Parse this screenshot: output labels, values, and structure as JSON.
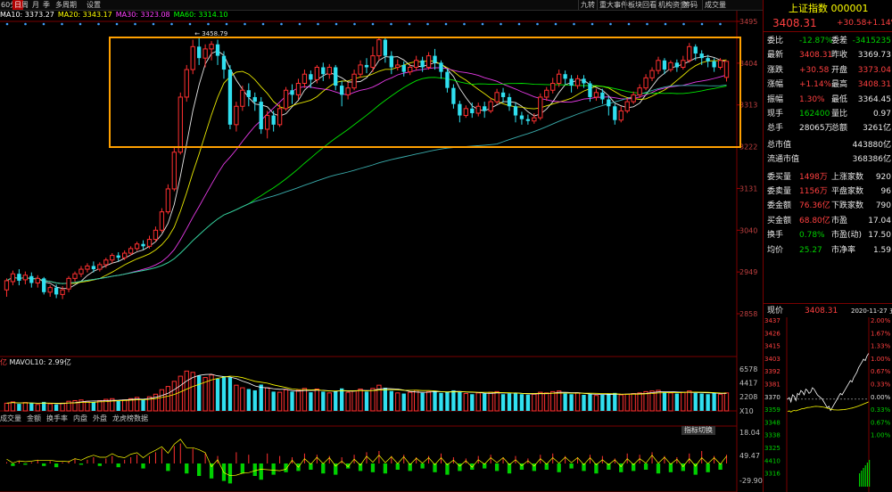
{
  "toolbar": {
    "left_items": [
      "60分",
      "日",
      "周",
      "月",
      "季",
      "多周期",
      "设置"
    ],
    "active_index": 1,
    "right_items": [
      "九转",
      "重大事件",
      "板块回看",
      "机构资金",
      "筹码",
      "成交量"
    ]
  },
  "ma_legend": [
    {
      "label": "MA10: 3373.27",
      "color": "#ffffff"
    },
    {
      "label": "MA20: 3343.17",
      "color": "#ffff00"
    },
    {
      "label": "MA30: 3323.08",
      "color": "#ff40ff"
    },
    {
      "label": "MA60: 3314.10",
      "color": "#00ff00"
    }
  ],
  "highlight_label": "3458.79",
  "annotations": {
    "peak_value": "3458.79"
  },
  "price_axis": [
    "3495",
    "3404",
    "3313",
    "3222",
    "3131",
    "3040",
    "2949",
    "2858"
  ],
  "volume_legend": {
    "prefix": "亿",
    "label": "MAVOL10: 2.99亿"
  },
  "volume_axis": [
    "6578",
    "4417",
    "2208",
    "X10"
  ],
  "bottom_tabs": [
    "成交量",
    "金额",
    "换手率",
    "内盘",
    "外盘",
    "龙虎榜数据"
  ],
  "indicator_button": "指标切换",
  "indicator_axis": [
    "18.04",
    "49.47",
    "-29.90"
  ],
  "right_panel": {
    "title": "上证指数 000001",
    "price": "3408.31",
    "change": "+30.58",
    "change_pct": "+1.14%",
    "rows": [
      {
        "l": "委比",
        "v": "-12.87%",
        "l2": "委差",
        "v2": "-3415235"
      },
      {
        "l": "最新",
        "v": "3408.31",
        "l2": "昨收",
        "v2": "3369.73"
      },
      {
        "l": "涨跌",
        "v": "+30.58",
        "l2": "开盘",
        "v2": "3373.04"
      },
      {
        "l": "涨幅",
        "v": "+1.14%",
        "l2": "最高",
        "v2": "3408.31"
      },
      {
        "l": "振幅",
        "v": "1.30%",
        "l2": "最低",
        "v2": "3364.45"
      },
      {
        "l": "现手",
        "v": "162400",
        "l2": "量比",
        "v2": "0.97"
      },
      {
        "l": "总手",
        "v": "28065万",
        "l2": "总额",
        "v2": "3261亿"
      },
      {
        "l": "总市值",
        "v": "",
        "l2": "",
        "v2": "443880亿"
      },
      {
        "l": "流通市值",
        "v": "",
        "l2": "",
        "v2": "368386亿"
      },
      {
        "l": "委买量",
        "v": "1498万",
        "l2": "上涨家数",
        "v2": "920"
      },
      {
        "l": "委卖量",
        "v": "1156万",
        "l2": "平盘家数",
        "v2": "96"
      },
      {
        "l": "委金额",
        "v": "76.36亿",
        "l2": "下跌家数",
        "v2": "790"
      },
      {
        "l": "买金额",
        "v": "68.80亿",
        "l2": "市盈",
        "v2": "17.04"
      },
      {
        "l": "换手",
        "v": "0.78%",
        "l2": "市盈(动)",
        "v2": "17.50"
      },
      {
        "l": "均价",
        "v": "25.27",
        "l2": "市净率",
        "v2": "1.59"
      }
    ],
    "intraday_header": {
      "label": "现价",
      "value": "3408.31",
      "date": "2020-11-27 五"
    },
    "intraday_left_axis": [
      "3437",
      "3426",
      "3415",
      "3403",
      "3392",
      "3381",
      "3370",
      "3359",
      "3348",
      "3338",
      "3325",
      "4410",
      "3316"
    ],
    "intraday_right_axis": [
      "2.00%",
      "1.67%",
      "1.33%",
      "1.00%",
      "0.67%",
      "0.33%",
      "0.00%",
      "0.33%",
      "0.67%",
      "1.00%"
    ]
  },
  "colors": {
    "up": "#ff3030",
    "down": "#30e0f0",
    "box": "#ffa000",
    "bg": "#000000"
  },
  "chart_data": {
    "type": "candlestick",
    "price_range": [
      2858,
      3495
    ],
    "candles": [
      [
        2910,
        2930,
        2895,
        2935
      ],
      [
        2928,
        2945,
        2920,
        2952
      ],
      [
        2945,
        2930,
        2920,
        2955
      ],
      [
        2932,
        2942,
        2922,
        2950
      ],
      [
        2940,
        2925,
        2915,
        2948
      ],
      [
        2925,
        2935,
        2915,
        2942
      ],
      [
        2935,
        2905,
        2900,
        2938
      ],
      [
        2905,
        2915,
        2895,
        2920
      ],
      [
        2915,
        2900,
        2892,
        2922
      ],
      [
        2900,
        2910,
        2890,
        2918
      ],
      [
        2912,
        2935,
        2905,
        2940
      ],
      [
        2935,
        2945,
        2928,
        2950
      ],
      [
        2945,
        2955,
        2938,
        2962
      ],
      [
        2955,
        2962,
        2948,
        2968
      ],
      [
        2962,
        2955,
        2948,
        2972
      ],
      [
        2955,
        2965,
        2950,
        2970
      ],
      [
        2965,
        2975,
        2958,
        2980
      ],
      [
        2975,
        2985,
        2968,
        2990
      ],
      [
        2985,
        2980,
        2972,
        2992
      ],
      [
        2980,
        2990,
        2975,
        2996
      ],
      [
        2990,
        3000,
        2985,
        3005
      ],
      [
        3000,
        3010,
        2995,
        3015
      ],
      [
        3010,
        3005,
        2998,
        3018
      ],
      [
        3005,
        3020,
        3000,
        3028
      ],
      [
        3020,
        3040,
        3015,
        3048
      ],
      [
        3040,
        3080,
        3035,
        3088
      ],
      [
        3080,
        3130,
        3075,
        3140
      ],
      [
        3130,
        3210,
        3125,
        3220
      ],
      [
        3210,
        3330,
        3205,
        3340
      ],
      [
        3330,
        3390,
        3320,
        3400
      ],
      [
        3390,
        3440,
        3380,
        3455
      ],
      [
        3440,
        3415,
        3400,
        3458
      ],
      [
        3415,
        3435,
        3395,
        3445
      ],
      [
        3435,
        3445,
        3410,
        3452
      ],
      [
        3445,
        3420,
        3400,
        3455
      ],
      [
        3420,
        3390,
        3370,
        3430
      ],
      [
        3390,
        3270,
        3260,
        3400
      ],
      [
        3270,
        3310,
        3255,
        3320
      ],
      [
        3310,
        3345,
        3300,
        3355
      ],
      [
        3345,
        3330,
        3310,
        3360
      ],
      [
        3330,
        3320,
        3300,
        3340
      ],
      [
        3320,
        3260,
        3250,
        3330
      ],
      [
        3260,
        3290,
        3240,
        3300
      ],
      [
        3290,
        3270,
        3255,
        3300
      ],
      [
        3270,
        3305,
        3265,
        3315
      ],
      [
        3305,
        3345,
        3300,
        3352
      ],
      [
        3345,
        3335,
        3315,
        3358
      ],
      [
        3335,
        3360,
        3325,
        3370
      ],
      [
        3360,
        3380,
        3350,
        3390
      ],
      [
        3380,
        3368,
        3350,
        3388
      ],
      [
        3368,
        3395,
        3360,
        3400
      ],
      [
        3395,
        3380,
        3365,
        3405
      ],
      [
        3380,
        3395,
        3370,
        3402
      ],
      [
        3395,
        3355,
        3345,
        3400
      ],
      [
        3355,
        3335,
        3310,
        3365
      ],
      [
        3335,
        3350,
        3325,
        3362
      ],
      [
        3350,
        3380,
        3345,
        3390
      ],
      [
        3380,
        3400,
        3372,
        3410
      ],
      [
        3400,
        3395,
        3382,
        3415
      ],
      [
        3395,
        3420,
        3385,
        3440
      ],
      [
        3420,
        3455,
        3410,
        3462
      ],
      [
        3455,
        3420,
        3405,
        3460
      ],
      [
        3420,
        3395,
        3380,
        3430
      ],
      [
        3395,
        3400,
        3388,
        3412
      ],
      [
        3400,
        3385,
        3375,
        3408
      ],
      [
        3385,
        3395,
        3378,
        3402
      ],
      [
        3395,
        3410,
        3388,
        3420
      ],
      [
        3410,
        3395,
        3385,
        3418
      ],
      [
        3395,
        3420,
        3390,
        3428
      ],
      [
        3420,
        3405,
        3390,
        3435
      ],
      [
        3405,
        3385,
        3370,
        3410
      ],
      [
        3385,
        3350,
        3340,
        3392
      ],
      [
        3350,
        3315,
        3305,
        3358
      ],
      [
        3315,
        3290,
        3275,
        3322
      ],
      [
        3290,
        3305,
        3285,
        3312
      ],
      [
        3305,
        3295,
        3285,
        3318
      ],
      [
        3295,
        3310,
        3288,
        3318
      ],
      [
        3310,
        3300,
        3285,
        3320
      ],
      [
        3300,
        3320,
        3295,
        3328
      ],
      [
        3320,
        3340,
        3315,
        3348
      ],
      [
        3340,
        3330,
        3318,
        3350
      ],
      [
        3330,
        3310,
        3300,
        3338
      ],
      [
        3310,
        3290,
        3275,
        3318
      ],
      [
        3290,
        3282,
        3270,
        3298
      ],
      [
        3282,
        3278,
        3270,
        3292
      ],
      [
        3278,
        3285,
        3272,
        3295
      ],
      [
        3285,
        3330,
        3280,
        3338
      ],
      [
        3330,
        3345,
        3322,
        3352
      ],
      [
        3345,
        3360,
        3338,
        3372
      ],
      [
        3360,
        3380,
        3352,
        3390
      ],
      [
        3380,
        3370,
        3358,
        3388
      ],
      [
        3370,
        3355,
        3340,
        3378
      ],
      [
        3355,
        3370,
        3348,
        3378
      ],
      [
        3370,
        3360,
        3350,
        3378
      ],
      [
        3360,
        3330,
        3320,
        3365
      ],
      [
        3330,
        3340,
        3322,
        3348
      ],
      [
        3340,
        3325,
        3315,
        3348
      ],
      [
        3325,
        3310,
        3290,
        3332
      ],
      [
        3310,
        3280,
        3270,
        3315
      ],
      [
        3280,
        3300,
        3275,
        3310
      ],
      [
        3300,
        3320,
        3295,
        3328
      ],
      [
        3320,
        3335,
        3315,
        3342
      ],
      [
        3335,
        3350,
        3328,
        3358
      ],
      [
        3350,
        3372,
        3345,
        3380
      ],
      [
        3372,
        3388,
        3365,
        3395
      ],
      [
        3388,
        3410,
        3380,
        3418
      ],
      [
        3410,
        3390,
        3380,
        3415
      ],
      [
        3390,
        3405,
        3385,
        3410
      ],
      [
        3405,
        3395,
        3385,
        3412
      ],
      [
        3395,
        3410,
        3390,
        3420
      ],
      [
        3410,
        3440,
        3405,
        3448
      ],
      [
        3440,
        3425,
        3410,
        3445
      ],
      [
        3425,
        3415,
        3400,
        3432
      ],
      [
        3415,
        3408,
        3395,
        3422
      ],
      [
        3408,
        3395,
        3385,
        3415
      ],
      [
        3395,
        3410,
        3390,
        3415
      ],
      [
        3373,
        3408,
        3364,
        3408
      ]
    ],
    "volumes": [
      1.2,
      1.4,
      1.1,
      1.3,
      1.2,
      1.0,
      1.4,
      1.1,
      1.0,
      1.2,
      1.5,
      1.6,
      1.7,
      1.5,
      1.4,
      1.6,
      1.8,
      1.9,
      1.6,
      1.7,
      1.9,
      2.1,
      1.8,
      2.2,
      2.6,
      3.3,
      3.8,
      4.6,
      5.4,
      6.2,
      6.0,
      5.5,
      5.2,
      5.6,
      5.0,
      5.4,
      5.2,
      4.0,
      3.6,
      3.4,
      3.2,
      4.1,
      3.6,
      3.0,
      2.9,
      3.3,
      3.0,
      3.2,
      3.5,
      2.9,
      3.4,
      3.0,
      2.8,
      3.1,
      3.5,
      2.9,
      3.1,
      3.4,
      3.0,
      3.5,
      4.0,
      3.6,
      3.1,
      2.8,
      2.7,
      2.9,
      3.2,
      2.8,
      3.0,
      3.1,
      2.8,
      3.0,
      3.2,
      3.0,
      2.7,
      2.6,
      2.8,
      2.7,
      2.9,
      3.0,
      2.6,
      2.7,
      2.8,
      2.6,
      2.5,
      2.6,
      2.9,
      2.8,
      3.0,
      3.1,
      2.7,
      2.6,
      2.8,
      2.5,
      2.6,
      2.4,
      2.5,
      2.7,
      2.8,
      2.5,
      2.6,
      2.7,
      2.8,
      3.0,
      3.1,
      3.2,
      2.9,
      2.8,
      2.7,
      2.9,
      3.1,
      2.8,
      2.7,
      2.6,
      2.8,
      2.6,
      2.8
    ],
    "indicator": [
      0.1,
      -0.2,
      0.2,
      -0.1,
      0.1,
      0.3,
      -0.2,
      0.2,
      -0.3,
      0.1,
      0.2,
      0.4,
      -0.1,
      0.3,
      0.5,
      -0.2,
      0.4,
      0.6,
      -0.3,
      0.3,
      0.5,
      0.7,
      -0.4,
      0.6,
      0.9,
      1.2,
      -0.6,
      1.4,
      1.6,
      -0.8,
      1.2,
      -1.0,
      0.8,
      -1.2,
      0.6,
      -1.4,
      -1.6,
      0.9,
      -0.8,
      0.7,
      -1.0,
      -1.3,
      0.8,
      -0.9,
      0.6,
      -0.7,
      0.5,
      -0.6,
      0.8,
      -0.5,
      0.7,
      -0.8,
      0.6,
      -0.9,
      0.5,
      -0.4,
      0.7,
      -0.6,
      0.9,
      -0.7,
      1.0,
      -0.8,
      0.6,
      -0.5,
      0.7,
      -0.6,
      0.5,
      -0.4,
      0.6,
      -0.7,
      0.8,
      -0.9,
      0.5,
      -0.6,
      0.4,
      -0.5,
      0.6,
      -0.4,
      0.7,
      -0.6,
      0.5,
      -0.8,
      0.6,
      -0.5,
      0.4,
      -0.6,
      0.7,
      -0.5,
      0.8,
      -0.7,
      0.6,
      -0.4,
      0.5,
      -0.6,
      0.7,
      -0.8,
      0.6,
      -0.5,
      0.4,
      -0.7,
      0.8,
      -0.6,
      0.7,
      -0.5,
      0.9,
      -0.8,
      0.6,
      -0.7,
      0.5,
      -0.6,
      0.8,
      -0.9,
      1.0,
      -0.7,
      0.6,
      -0.5,
      0.7
    ]
  }
}
